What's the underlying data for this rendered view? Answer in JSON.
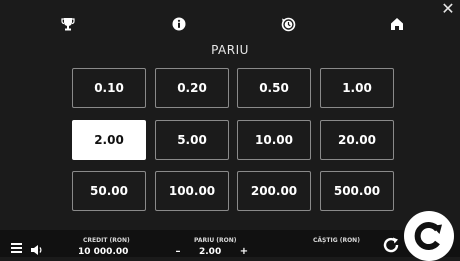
{
  "top_nav": {
    "icons": [
      "trophy-icon",
      "info-icon",
      "history-icon",
      "home-icon"
    ],
    "close": "✕"
  },
  "section_title": "PARIU",
  "bet_options": [
    "0.10",
    "0.20",
    "0.50",
    "1.00",
    "2.00",
    "5.00",
    "10.00",
    "20.00",
    "50.00",
    "100.00",
    "200.00",
    "500.00"
  ],
  "selected_bet": "2.00",
  "bottom_bar": {
    "credit_label": "CREDIT (RON)",
    "credit_value": "10 000.00",
    "bet_label": "PARIU (RON)",
    "bet_value": "2.00",
    "minus": "–",
    "plus": "+",
    "win_label": "CÂȘTIG (RON)"
  },
  "colors": {
    "background": "#1b1b1b",
    "bottom_bar": "#111111",
    "button_border": "#8a8a8a",
    "selected_fill": "#ffffff"
  }
}
